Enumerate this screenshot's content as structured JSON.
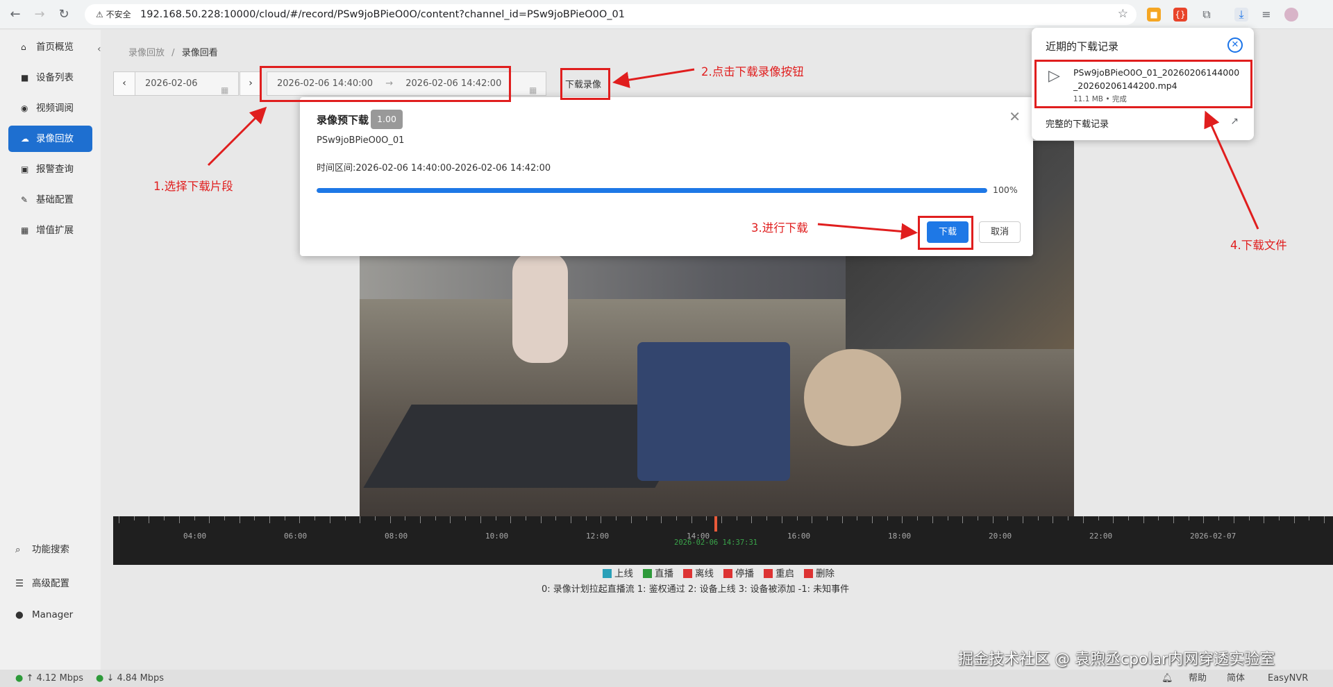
{
  "browser": {
    "secure_label": "不安全",
    "url": "192.168.50.228:10000/cloud/#/record/PSw9joBPieO0O/content?channel_id=PSw9joBPieO0O_01"
  },
  "sidebar": {
    "items": [
      {
        "label": "首页概览"
      },
      {
        "label": "设备列表"
      },
      {
        "label": "视频调阅"
      },
      {
        "label": "录像回放"
      },
      {
        "label": "报警查询"
      },
      {
        "label": "基础配置"
      },
      {
        "label": "增值扩展"
      }
    ],
    "bottom": [
      {
        "label": "功能搜索"
      },
      {
        "label": "高级配置"
      },
      {
        "label": "Manager"
      }
    ]
  },
  "breadcrumb": {
    "parent": "录像回放",
    "separator": "/",
    "current": "录像回看"
  },
  "toolbar": {
    "date": "2026-02-06",
    "range_start": "2026-02-06 14:40:00",
    "range_arrow": "→",
    "range_end": "2026-02-06 14:42:00",
    "download_label": "下载录像"
  },
  "timeline": {
    "labels": [
      "04:00",
      "06:00",
      "08:00",
      "10:00",
      "12:00",
      "14:00",
      "16:00",
      "18:00",
      "20:00",
      "22:00",
      "2026-02-07"
    ],
    "cursor_time": "2026-02-06 14:37:31"
  },
  "legend": [
    {
      "label": "上线",
      "color": "#2aa0b8"
    },
    {
      "label": "直播",
      "color": "#2e9a3a"
    },
    {
      "label": "离线",
      "color": "#d33"
    },
    {
      "label": "停播",
      "color": "#d33"
    },
    {
      "label": "重启",
      "color": "#d33"
    },
    {
      "label": "删除",
      "color": "#d33"
    }
  ],
  "events_text": "0: 录像计划拉起直播流    1: 鉴权通过    2: 设备上线    3: 设备被添加    -1: 未知事件",
  "modal": {
    "title": "录像预下载",
    "badge": "1.00",
    "channel_id": "PSw9joBPieO0O_01",
    "range_text": "时间区间:2026-02-06 14:40:00-2026-02-06 14:42:00",
    "progress": 1.0,
    "progress_text": "100%",
    "confirm_label": "下载",
    "cancel_label": "取消"
  },
  "downloads": {
    "title": "近期的下载记录",
    "file_name": "PSw9joBPieO0O_01_20260206144000_20260206144200.mp4",
    "file_meta": "11.1 MB • 完成",
    "all_label": "完整的下载记录"
  },
  "annotations": {
    "step1": "1.选择下载片段",
    "step2": "2.点击下载录像按钮",
    "step3": "3.进行下载",
    "step4": "4.下载文件"
  },
  "statusbar": {
    "up": "↑ 4.12 Mbps",
    "down": "↓ 4.84 Mbps",
    "help": "帮助",
    "lang": "简体",
    "brand": "EasyNVR"
  },
  "watermark": "掘金技术社区 @ 袁煦丞cpolar内网穿透实验室",
  "colors": {
    "accent": "#1e78e6",
    "annotation": "#e01e1e"
  }
}
